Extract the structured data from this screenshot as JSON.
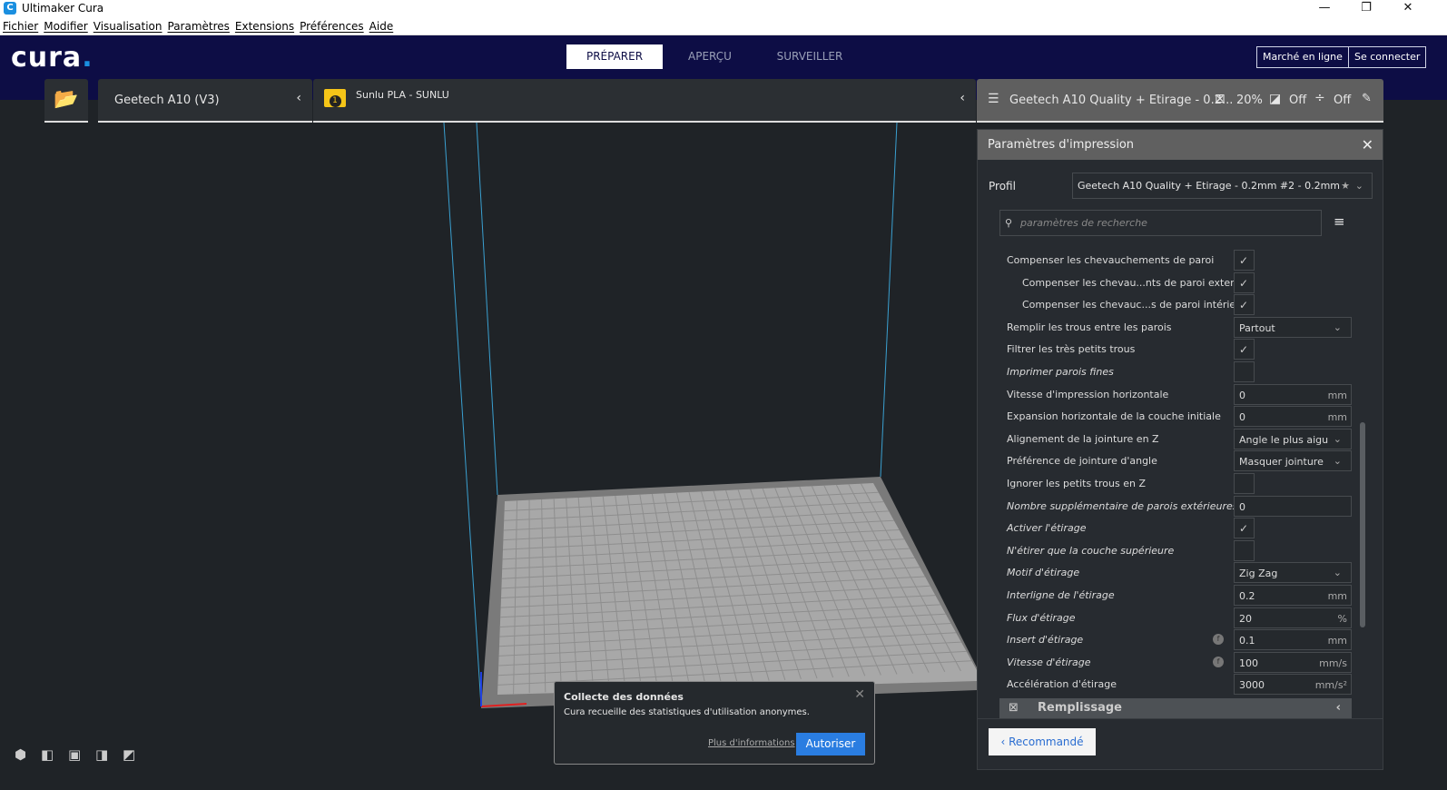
{
  "window": {
    "title": "Ultimaker Cura",
    "minimize": "—",
    "maximize": "❐",
    "close": "✕"
  },
  "menu": [
    "Fichier",
    "Modifier",
    "Visualisation",
    "Paramètres",
    "Extensions",
    "Préférences",
    "Aide"
  ],
  "header": {
    "logo": "cura",
    "tabs": [
      {
        "label": "PRÉPARER",
        "active": true
      },
      {
        "label": "APERÇU",
        "active": false
      },
      {
        "label": "SURVEILLER",
        "active": false
      }
    ],
    "marketplace": "Marché en ligne",
    "signin": "Se connecter"
  },
  "toolbar": {
    "printer": "Geetech A10 (V3)",
    "material_badge": "1",
    "material": "Sunlu PLA - SUNLU",
    "profile_summary": "Geetech A10 Quality + Etirage - 0.2...",
    "infill": "20%",
    "support": "Off",
    "adhesion": "Off"
  },
  "panel": {
    "title": "Paramètres d'impression",
    "profile_label": "Profil",
    "profile_value": "Geetech A10 Quality + Etirage - 0.2mm #2 - 0.2mm",
    "search_placeholder": "paramètres de recherche",
    "settings": [
      {
        "label": "Compenser les chevauchements de paroi",
        "type": "check",
        "checked": true
      },
      {
        "label": "Compenser les chevau...nts de paroi externe",
        "type": "check",
        "checked": true,
        "indent": true
      },
      {
        "label": "Compenser les chevauc...s de paroi intérieure",
        "type": "check",
        "checked": true,
        "indent": true
      },
      {
        "label": "Remplir les trous entre les parois",
        "type": "select",
        "value": "Partout"
      },
      {
        "label": "Filtrer les très petits trous",
        "type": "check",
        "checked": true
      },
      {
        "label": "Imprimer parois fines",
        "type": "check",
        "checked": false,
        "italic": true
      },
      {
        "label": "Vitesse d'impression horizontale",
        "type": "field",
        "value": "0",
        "unit": "mm"
      },
      {
        "label": "Expansion horizontale de la couche initiale",
        "type": "field",
        "value": "0",
        "unit": "mm"
      },
      {
        "label": "Alignement de la jointure en Z",
        "type": "select",
        "value": "Angle le plus aigu"
      },
      {
        "label": "Préférence de jointure d'angle",
        "type": "select",
        "value": "Masquer jointure"
      },
      {
        "label": "Ignorer les petits trous en Z",
        "type": "check",
        "checked": false
      },
      {
        "label": "Nombre supplémentaire de parois extérieures",
        "type": "field",
        "value": "0",
        "unit": "",
        "italic": true
      },
      {
        "label": "Activer l'étirage",
        "type": "check",
        "checked": true,
        "italic": true
      },
      {
        "label": "N'étirer que la couche supérieure",
        "type": "check",
        "checked": false,
        "italic": true
      },
      {
        "label": "Motif d'étirage",
        "type": "select",
        "value": "Zig Zag",
        "italic": true
      },
      {
        "label": "Interligne de l'étirage",
        "type": "field",
        "value": "0.2",
        "unit": "mm",
        "italic": true
      },
      {
        "label": "Flux d'étirage",
        "type": "field",
        "value": "20",
        "unit": "%",
        "italic": true
      },
      {
        "label": "Insert d'étirage",
        "type": "field",
        "value": "0.1",
        "unit": "mm",
        "italic": true,
        "fx": true
      },
      {
        "label": "Vitesse d'étirage",
        "type": "field",
        "value": "100",
        "unit": "mm/s",
        "italic": true,
        "fx": true
      },
      {
        "label": "Accélération d'étirage",
        "type": "field",
        "value": "3000",
        "unit": "mm/s²"
      }
    ],
    "category": "Remplissage",
    "recommended": "Recommandé"
  },
  "toast": {
    "title": "Collecte des données",
    "message": "Cura recueille des statistiques d'utilisation anonymes.",
    "more": "Plus d'informations",
    "allow": "Autoriser"
  },
  "colors": {
    "header": "#0d0d45",
    "accent": "#1a8fe0",
    "button": "#2a7de1"
  }
}
